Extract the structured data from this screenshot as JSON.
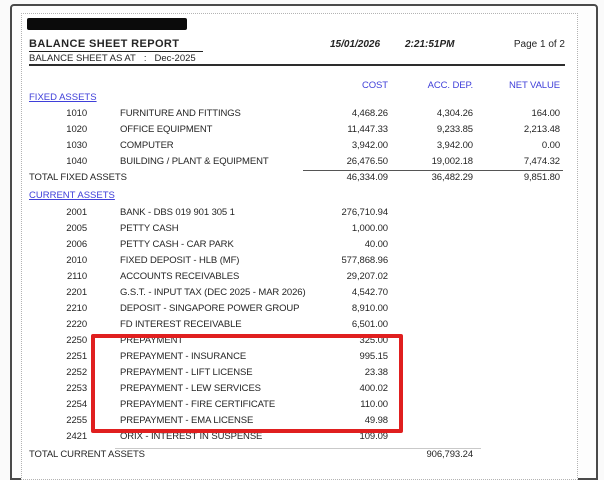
{
  "header": {
    "company_name_redacted": true,
    "title": "BALANCE SHEET REPORT",
    "date": "15/01/2026",
    "time": "2:21:51PM",
    "page_label": "Page 1 of 2",
    "as_at_label": "BALANCE SHEET AS AT",
    "as_at_sep": ":",
    "as_at_value": "Dec-2025"
  },
  "columns": {
    "cost": "COST",
    "acc_dep": "ACC. DEP.",
    "net_value": "NET VALUE"
  },
  "fixed_assets": {
    "heading": "FIXED ASSETS",
    "rows": [
      {
        "code": "1010",
        "name": "FURNITURE AND FITTINGS",
        "cost": "4,468.26",
        "acc_dep": "4,304.26",
        "net": "164.00"
      },
      {
        "code": "1020",
        "name": "OFFICE EQUIPMENT",
        "cost": "11,447.33",
        "acc_dep": "9,233.85",
        "net": "2,213.48"
      },
      {
        "code": "1030",
        "name": "COMPUTER",
        "cost": "3,942.00",
        "acc_dep": "3,942.00",
        "net": "0.00"
      },
      {
        "code": "1040",
        "name": "BUILDING / PLANT & EQUIPMENT",
        "cost": "26,476.50",
        "acc_dep": "19,002.18",
        "net": "7,474.32"
      }
    ],
    "total_label": "TOTAL FIXED ASSETS",
    "total_cost": "46,334.09",
    "total_acc_dep": "36,482.29",
    "total_net": "9,851.80"
  },
  "current_assets": {
    "heading": "CURRENT ASSETS",
    "rows": [
      {
        "code": "2001",
        "name": "BANK - DBS 019 901 305 1",
        "cost": "276,710.94"
      },
      {
        "code": "2005",
        "name": "PETTY CASH",
        "cost": "1,000.00"
      },
      {
        "code": "2006",
        "name": "PETTY CASH - CAR PARK",
        "cost": "40.00"
      },
      {
        "code": "2010",
        "name": "FIXED DEPOSIT - HLB (MF)",
        "cost": "577,868.96"
      },
      {
        "code": "2110",
        "name": "ACCOUNTS RECEIVABLES",
        "cost": "29,207.02"
      },
      {
        "code": "2201",
        "name": "G.S.T. - INPUT TAX (DEC 2025 - MAR 2026)",
        "cost": "4,542.70"
      },
      {
        "code": "2210",
        "name": "DEPOSIT - SINGAPORE POWER GROUP",
        "cost": "8,910.00"
      },
      {
        "code": "2220",
        "name": "FD INTEREST RECEIVABLE",
        "cost": "6,501.00"
      },
      {
        "code": "2250",
        "name": "PREPAYMENT",
        "cost": "325.00"
      },
      {
        "code": "2251",
        "name": "PREPAYMENT - INSURANCE",
        "cost": "995.15"
      },
      {
        "code": "2252",
        "name": "PREPAYMENT - LIFT LICENSE",
        "cost": "23.38"
      },
      {
        "code": "2253",
        "name": "PREPAYMENT - LEW SERVICES",
        "cost": "400.02"
      },
      {
        "code": "2254",
        "name": "PREPAYMENT - FIRE CERTIFICATE",
        "cost": "110.00"
      },
      {
        "code": "2255",
        "name": "PREPAYMENT - EMA LICENSE",
        "cost": "49.98"
      },
      {
        "code": "2421",
        "name": "ORIX - INTEREST IN SUSPENSE",
        "cost": "109.09"
      }
    ],
    "total_label": "TOTAL CURRENT ASSETS",
    "total_value": "906,793.24"
  },
  "annotation": {
    "highlight_color": "#e01f1f",
    "highlighted_codes": [
      "2250",
      "2251",
      "2252",
      "2253",
      "2254",
      "2255"
    ]
  },
  "colors": {
    "accent_blue": "#3f3fd9",
    "text": "#252525"
  }
}
